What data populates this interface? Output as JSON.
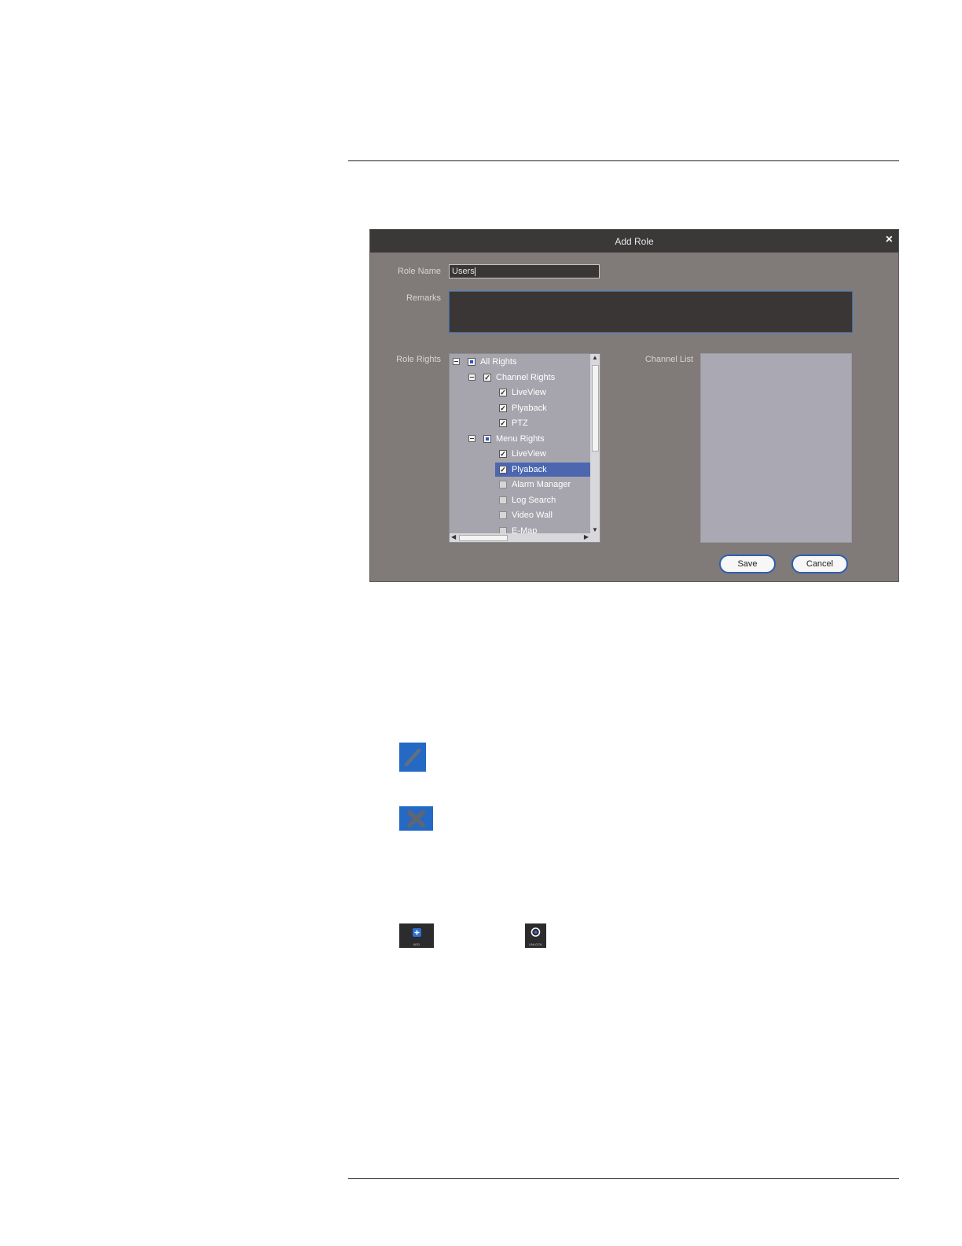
{
  "dialog": {
    "title": "Add Role",
    "close_glyph": "×",
    "role_name_label": "Role Name",
    "role_name_value": "Users",
    "remarks_label": "Remarks",
    "remarks_value": "",
    "role_rights_label": "Role Rights",
    "channel_list_label": "Channel List",
    "tree": [
      {
        "label": "All Rights",
        "state": "partial",
        "expander": true,
        "level": 0
      },
      {
        "label": "Channel Rights",
        "state": "checked",
        "expander": true,
        "level": 1
      },
      {
        "label": "LiveView",
        "state": "checked",
        "expander": false,
        "level": 2
      },
      {
        "label": "Plyaback",
        "state": "checked",
        "expander": false,
        "level": 2
      },
      {
        "label": "PTZ",
        "state": "checked",
        "expander": false,
        "level": 2
      },
      {
        "label": "Menu Rights",
        "state": "partial",
        "expander": true,
        "level": 1
      },
      {
        "label": "LiveView",
        "state": "checked",
        "expander": false,
        "level": 2
      },
      {
        "label": "Plyaback",
        "state": "checked",
        "expander": false,
        "level": 2,
        "selected": true
      },
      {
        "label": "Alarm Manager",
        "state": "unchecked",
        "expander": false,
        "level": 2
      },
      {
        "label": "Log Search",
        "state": "unchecked",
        "expander": false,
        "level": 2
      },
      {
        "label": "Video Wall",
        "state": "unchecked",
        "expander": false,
        "level": 2
      },
      {
        "label": "E-Map",
        "state": "unchecked",
        "expander": false,
        "level": 2
      }
    ],
    "save_label": "Save",
    "cancel_label": "Cancel",
    "check_glyph": "✓"
  },
  "icons": {
    "edit": "edit-icon",
    "delete": "delete-icon",
    "add": "add-icon",
    "add_caption": "ADD",
    "unlock": "unlock-icon",
    "unlock_caption": "UNLOCK"
  },
  "colors": {
    "dialog_bg": "#807a78",
    "titlebar_bg": "#3b3838",
    "accent_blue": "#2469c4",
    "selection": "#4c67b0"
  }
}
